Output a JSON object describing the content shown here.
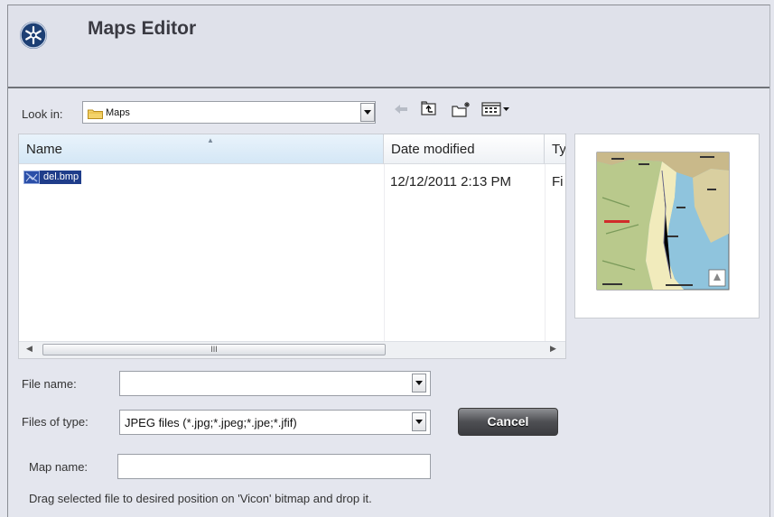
{
  "window": {
    "title": "Maps Editor",
    "logo_icon": "app-logo-icon"
  },
  "look_in": {
    "label": "Look in:",
    "value": "Maps",
    "folder_icon": "folder-icon"
  },
  "toolbar": {
    "back_icon": "back-arrow-icon",
    "up_icon": "up-folder-icon",
    "new_folder_icon": "new-folder-icon",
    "view_icon": "view-menu-icon"
  },
  "file_list": {
    "columns": [
      "Name",
      "Date modified",
      "Type"
    ],
    "type_header_visible": "Ty",
    "rows": [
      {
        "name": "del.bmp",
        "date_modified": "12/12/2011 2:13 PM",
        "type_visible": "Fi"
      }
    ],
    "scroll_grip": "III"
  },
  "form": {
    "file_name_label": "File name:",
    "file_name_value": "",
    "files_of_type_label": "Files of type:",
    "files_of_type_value": "JPEG files (*.jpg;*.jpeg;*.jpe;*.jfif)",
    "map_name_label": "Map name:",
    "map_name_value": "",
    "cancel_label": "Cancel"
  },
  "hint": "Drag selected file to desired position on 'Vicon' bitmap and drop it.",
  "colors": {
    "selection": "#1f3d8a",
    "title_bg": "#dfe1ea",
    "logo": "#1d3f74"
  }
}
